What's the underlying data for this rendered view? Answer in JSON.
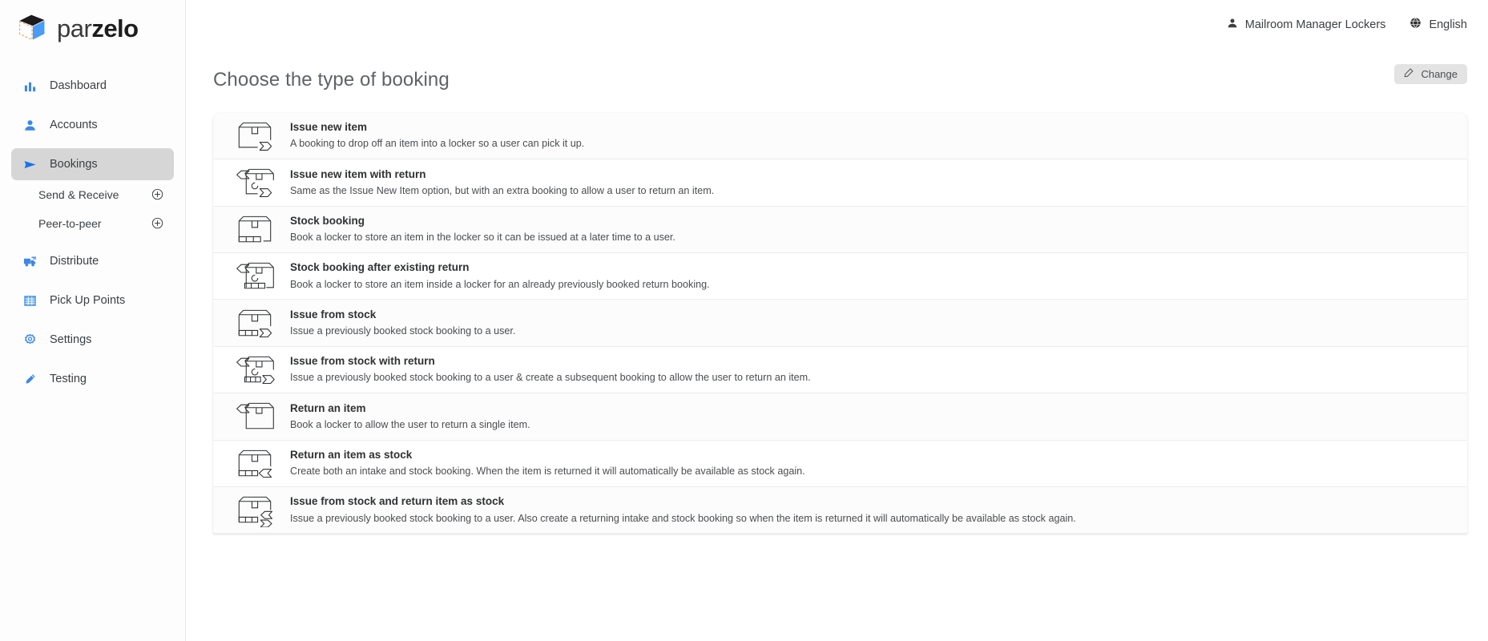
{
  "brand": {
    "name_light": "par",
    "name_bold": "zelo",
    "logo_icon": "cube-logo-icon",
    "accent_blue": "#4a9cf6",
    "accent_orange": "#f0a463"
  },
  "sidebar": {
    "items": [
      {
        "label": "Dashboard",
        "icon": "bar-chart-icon",
        "active": false
      },
      {
        "label": "Accounts",
        "icon": "person-icon",
        "active": false
      },
      {
        "label": "Bookings",
        "icon": "send-arrow-icon",
        "active": true
      },
      {
        "label": "Distribute",
        "icon": "delivery-truck-icon",
        "active": false
      },
      {
        "label": "Pick Up Points",
        "icon": "grid-table-icon",
        "active": false
      },
      {
        "label": "Settings",
        "icon": "gear-icon",
        "active": false
      },
      {
        "label": "Testing",
        "icon": "test-tube-icon",
        "active": false
      }
    ],
    "sub_items": [
      {
        "label": "Send & Receive",
        "icon": "plus-circle-icon"
      },
      {
        "label": "Peer-to-peer",
        "icon": "plus-circle-icon"
      }
    ]
  },
  "topbar": {
    "user": {
      "label": "Mailroom Manager Lockers",
      "icon": "person-icon"
    },
    "language": {
      "label": "English",
      "icon": "globe-icon"
    }
  },
  "page": {
    "title": "Choose the type of booking",
    "change_button": {
      "label": "Change",
      "icon": "pencil-icon"
    }
  },
  "booking_types": [
    {
      "title": "Issue new item",
      "desc": "A booking to drop off an item into a locker so a user can pick it up.",
      "icon": "box-out-icon"
    },
    {
      "title": "Issue new item with return",
      "desc": "Same as the Issue New Item option, but with an extra booking to allow a user to return an item.",
      "icon": "box-in-return-out-icon"
    },
    {
      "title": "Stock booking",
      "desc": "Book a locker to store an item in the locker so it can be issued at a later time to a user.",
      "icon": "box-stock-icon"
    },
    {
      "title": "Stock booking after existing return",
      "desc": "Book a locker to store an item inside a locker for an already previously booked return booking.",
      "icon": "box-in-return-stock-icon"
    },
    {
      "title": "Issue from stock",
      "desc": "Issue a previously booked stock booking to a user.",
      "icon": "box-stock-out-icon"
    },
    {
      "title": "Issue from stock with return",
      "desc": "Issue a previously booked stock booking to a user & create a subsequent booking to allow the user to return an item.",
      "icon": "box-in-return-stock-out-icon"
    },
    {
      "title": "Return an item",
      "desc": "Book a locker to allow the user to return a single item.",
      "icon": "box-in-icon"
    },
    {
      "title": "Return an item as stock",
      "desc": "Create both an intake and stock booking. When the item is returned it will automatically be available as stock again.",
      "icon": "box-stock-in-icon"
    },
    {
      "title": "Issue from stock and return item as stock",
      "desc": "Issue a previously booked stock booking to a user. Also create a returning intake and stock booking so when the item is returned it will automatically be available as stock again.",
      "icon": "box-stock-in-out-icon"
    }
  ]
}
